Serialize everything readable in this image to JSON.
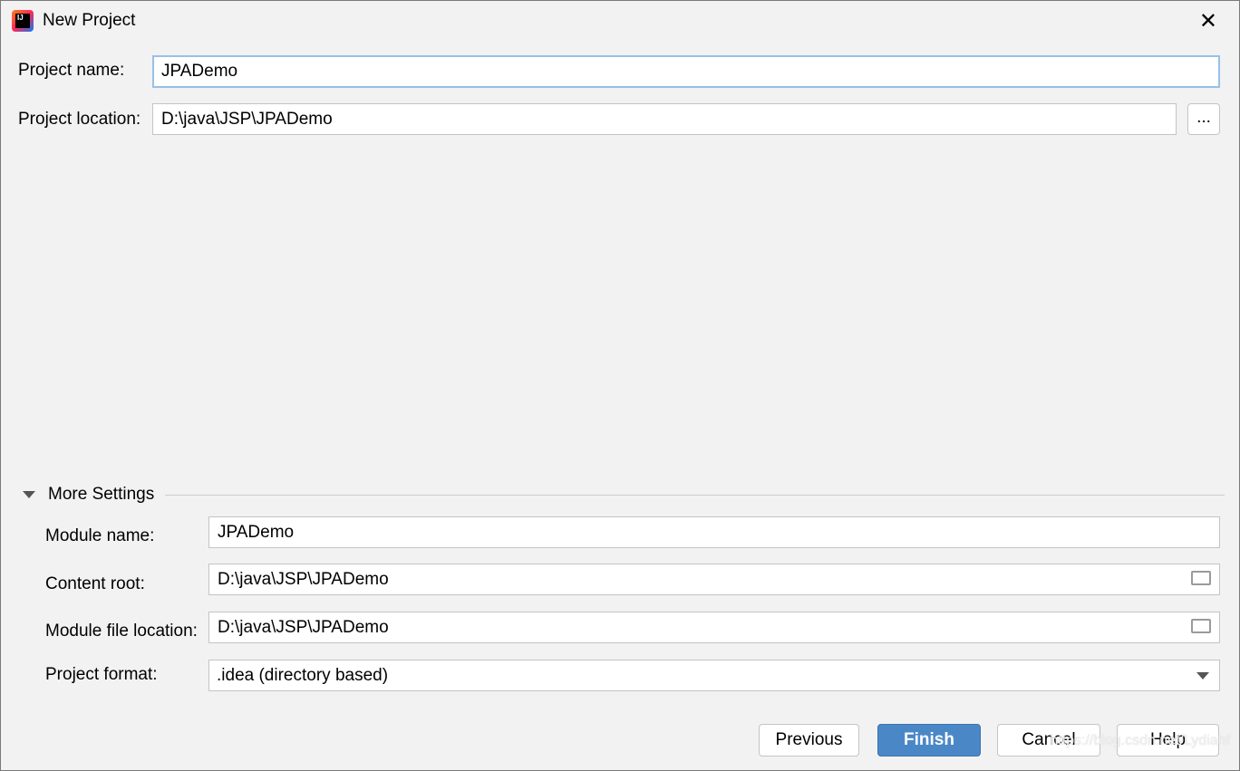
{
  "window": {
    "title": "New Project",
    "icon": "intellij-idea-icon",
    "close_icon": "close-icon"
  },
  "form": {
    "project_name": {
      "label": "Project name:",
      "value": "JPADemo"
    },
    "project_location": {
      "label": "Project location:",
      "value": "D:\\java\\JSP\\JPADemo",
      "browse_label": "..."
    }
  },
  "more_settings": {
    "title": "More Settings",
    "expanded": true,
    "module_name": {
      "label": "Module name:",
      "value": "JPADemo"
    },
    "content_root": {
      "label": "Content root:",
      "value": "D:\\java\\JSP\\JPADemo"
    },
    "module_file_location": {
      "label": "Module file location:",
      "value": "D:\\java\\JSP\\JPADemo"
    },
    "project_format": {
      "label": "Project format:",
      "value": ".idea (directory based)"
    }
  },
  "buttons": {
    "previous": "Previous",
    "finish": "Finish",
    "cancel": "Cancel",
    "help": "Help"
  },
  "watermark": "https://blog.csdn.net/Lydiahf",
  "colors": {
    "primary": "#4a87c7",
    "focus": "#97c0ea"
  }
}
